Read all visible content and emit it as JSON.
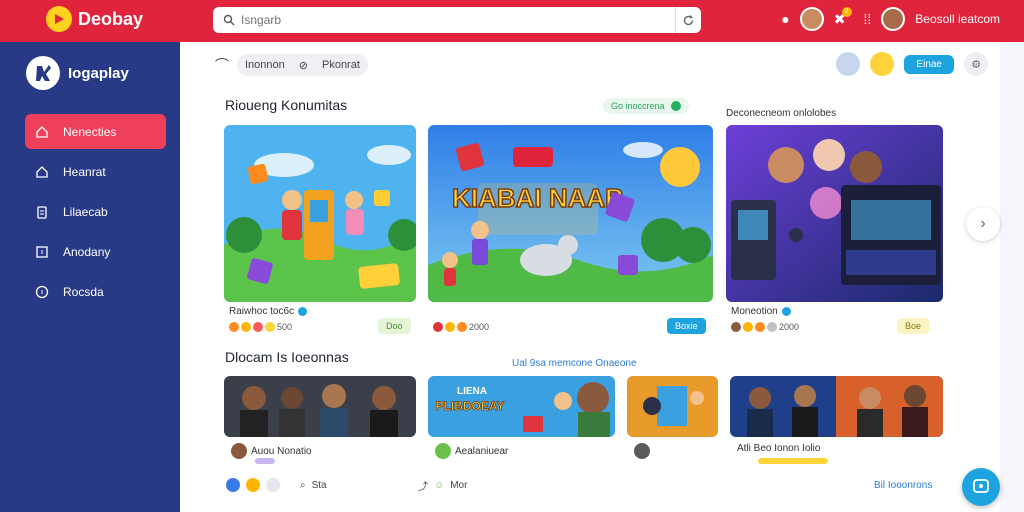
{
  "app": {
    "name": "Deobay",
    "brand_color": "#e0243c",
    "sidebar_color": "#283a85",
    "accent": "#1da3e0"
  },
  "search": {
    "placeholder": "Isngarb"
  },
  "header": {
    "username": "Beosoll ieatcom",
    "notifications": "2"
  },
  "sidebar": {
    "brand": "Iogaplay",
    "items": [
      {
        "label": "Nenecties",
        "icon": "home-outline-icon",
        "active": true
      },
      {
        "label": "Heanrat",
        "icon": "home-icon"
      },
      {
        "label": "Lilaecab",
        "icon": "clipboard-icon"
      },
      {
        "label": "Anodany",
        "icon": "square-icon"
      },
      {
        "label": "Rocsda",
        "icon": "circle-info-icon"
      }
    ]
  },
  "subbar": {
    "tabs": [
      "Inonnon",
      "Pkonrat"
    ],
    "button_label": "Einae"
  },
  "section1": {
    "title": "Rioueng Konumitas",
    "pill": "Go inoccrena",
    "right_title": "Deconecneom onlolobes",
    "cards": [
      {
        "title": "Raiwhoc toc6c",
        "count": "500",
        "tag": "Doo"
      },
      {
        "title": "KIABAI NAAB",
        "count": "2000",
        "tag": "Boxie"
      },
      {
        "title": "Moneotion",
        "count": "2000",
        "tag": "Boe"
      }
    ]
  },
  "section2": {
    "title": "Dlocam Is Ioeonnas",
    "link": "Ual 9sa memcone Onaeone",
    "videos": [
      {
        "title": "Auou Nonatio"
      },
      {
        "title": "Aealaniuear",
        "banner": "PLIBDOEAY",
        "banner_top": "LIENA"
      },
      {
        "title": ""
      },
      {
        "title": "Atli Beo Ionon Iolio"
      }
    ],
    "actions": [
      {
        "label": "Sta"
      },
      {
        "label": "Mor"
      }
    ],
    "bottom_link": "Bil Iooonrons"
  }
}
